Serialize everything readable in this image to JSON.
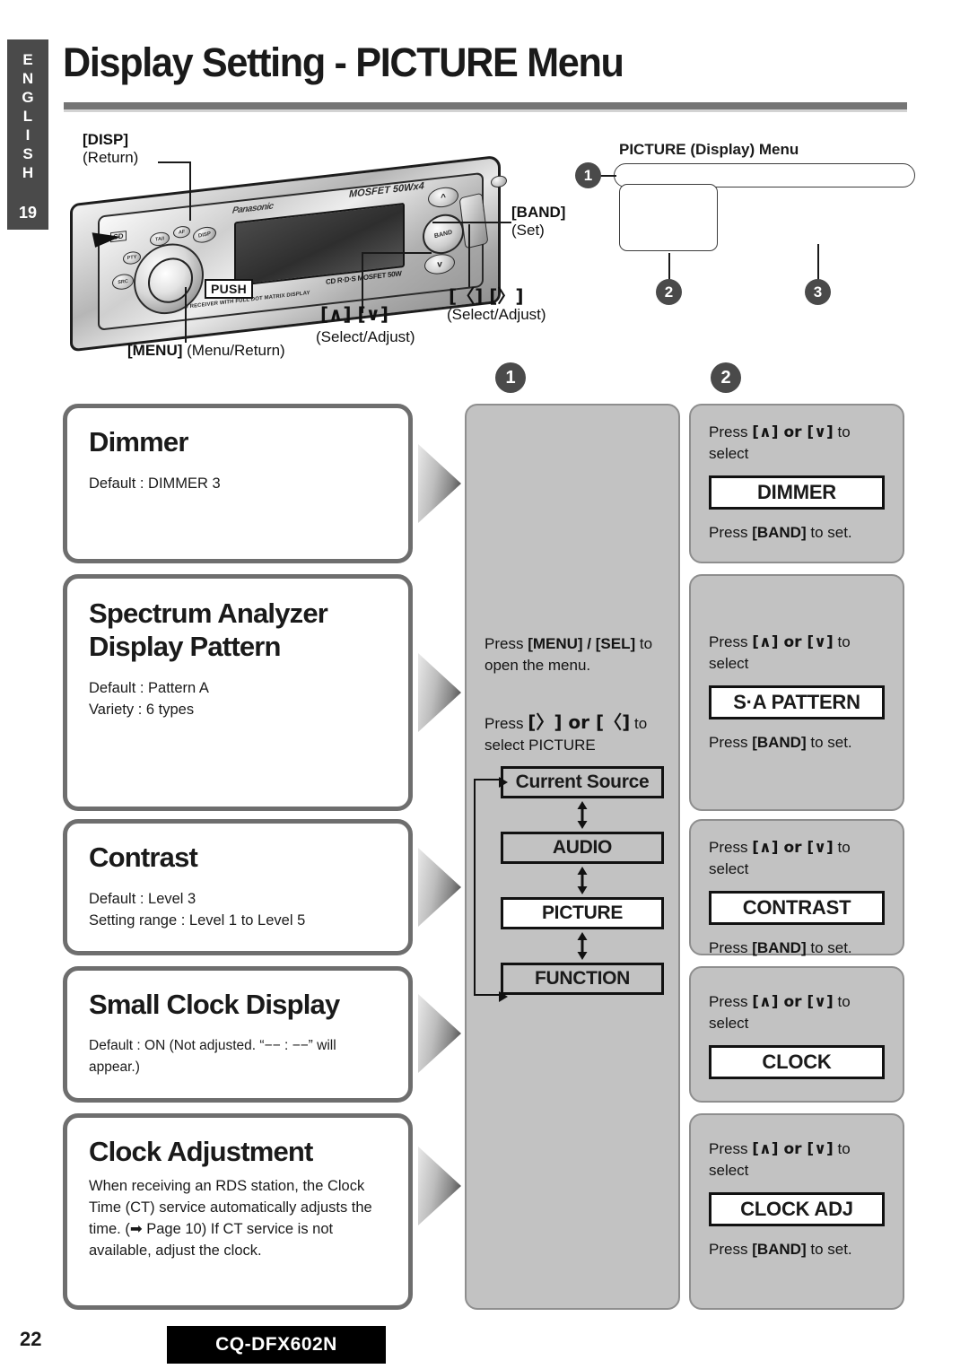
{
  "sidebar": {
    "language_letters": [
      "E",
      "N",
      "G",
      "L",
      "I",
      "S",
      "H"
    ],
    "section_number": "19"
  },
  "header": {
    "title": "Display Setting - PICTURE Menu"
  },
  "unit_diagram": {
    "callouts": [
      {
        "label": "[DISP]",
        "sub": "(Return)"
      },
      {
        "label": "[BAND]",
        "sub": "(Set)"
      },
      {
        "label": "[〈] [〉]",
        "sub": "(Select/Adjust)"
      },
      {
        "label": "[∧] [∨]",
        "sub": "(Select/Adjust)"
      },
      {
        "label": "[MENU]",
        "sub": "(Menu/Return)"
      }
    ],
    "push_label": "PUSH",
    "brand": "Panasonic",
    "mosfet": "MOSFET 50Wx4",
    "cd_logo": "CD",
    "rds_tag": "CD R·D·S MOSFET 50W",
    "dot_matrix": "CD RECEIVER WITH FULL DOT MATRIX DISPLAY",
    "disp_btn": "DISP",
    "band_btn": "BAND",
    "buttons": {
      "tai": "TA/I",
      "af": "AF",
      "pty": "PTY",
      "src": "SRC"
    }
  },
  "picture_menu_callout": {
    "title": "PICTURE (Display) Menu",
    "markers": [
      "1",
      "2",
      "3"
    ]
  },
  "column_markers": {
    "step1": "1",
    "step2": "2"
  },
  "settings": [
    {
      "title": "Dimmer",
      "lines": [
        "Default : DIMMER 3"
      ]
    },
    {
      "title": "Spectrum Analyzer Display Pattern",
      "title_line1": "Spectrum Analyzer",
      "title_line2": "Display Pattern",
      "lines": [
        "Default : Pattern A",
        "Variety : 6 types"
      ]
    },
    {
      "title": "Contrast",
      "lines": [
        "Default : Level 3",
        "Setting range : Level 1 to Level 5"
      ]
    },
    {
      "title": "Small Clock Display",
      "lines": [
        "Default : ON (Not adjusted.  “−− : −−” will appear.)"
      ]
    },
    {
      "title": "Clock Adjustment",
      "lines": [
        "When receiving an RDS station, the Clock Time (CT) service automatically adjusts the time. (➡ Page 10)  If CT service is not available, adjust the clock."
      ]
    }
  ],
  "step1_panel": {
    "instruction1_pre": "Press ",
    "instruction1_keys": "[MENU] / [SEL]",
    "instruction1_post": " to open the menu.",
    "instruction2_pre": "Press  ",
    "instruction2_keys": "[〉] or [〈]",
    "instruction2_post": " to select PICTURE",
    "menu_chain": [
      {
        "label": "Current Source",
        "selected": false
      },
      {
        "label": "AUDIO",
        "selected": false
      },
      {
        "label": "PICTURE",
        "selected": true
      },
      {
        "label": "FUNCTION",
        "selected": false
      }
    ]
  },
  "step2_panels": [
    {
      "press_pre": "Press ",
      "press_keys": "[∧] or [∨]",
      "press_post": " to select",
      "chip": "DIMMER",
      "set_pre": "Press ",
      "set_keys": "[BAND]",
      "set_post": " to set."
    },
    {
      "press_pre": "Press ",
      "press_keys": "[∧] or [∨]",
      "press_post": " to select",
      "chip": "S·A PATTERN",
      "set_pre": "Press ",
      "set_keys": "[BAND]",
      "set_post": " to set."
    },
    {
      "press_pre": "Press ",
      "press_keys": "[∧] or [∨]",
      "press_post": " to select",
      "chip": "CONTRAST",
      "set_pre": "Press ",
      "set_keys": "[BAND]",
      "set_post": " to set."
    },
    {
      "press_pre": "Press ",
      "press_keys": "[∧] or [∨]",
      "press_post": " to select",
      "chip": "CLOCK",
      "set_pre": "",
      "set_keys": "",
      "set_post": ""
    },
    {
      "press_pre": "Press ",
      "press_keys": "[∧] or [∨]",
      "press_post": " to select",
      "chip": "CLOCK ADJ",
      "set_pre": "Press ",
      "set_keys": "[BAND]",
      "set_post": " to set."
    }
  ],
  "footer": {
    "page_number": "22",
    "model": "CQ-DFX602N"
  },
  "colors": {
    "sidebar": "#4a4a4a",
    "panel_gray": "#c2c2c2",
    "card_border": "#6e6e6e",
    "rule": "#757575"
  }
}
